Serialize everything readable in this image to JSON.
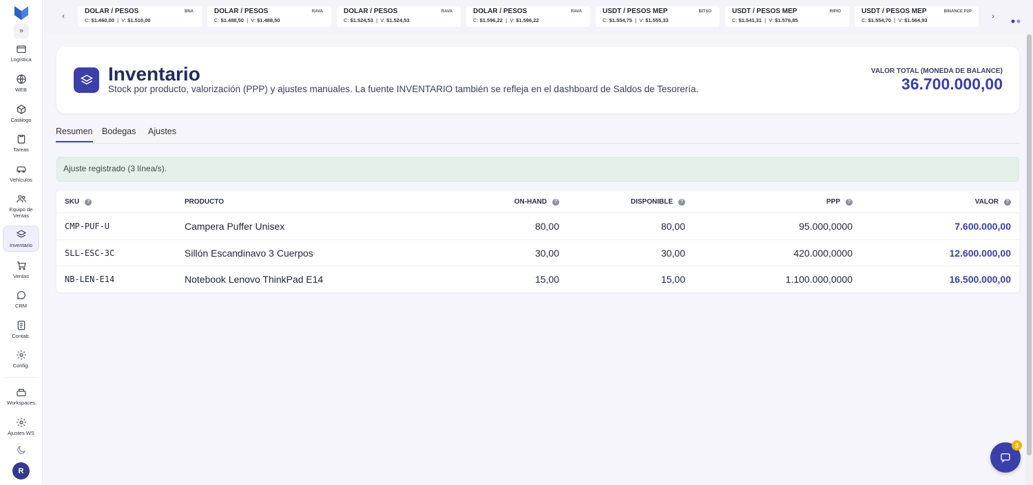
{
  "sidebar": {
    "items": [
      {
        "label": "Logística",
        "icon": "box-icon"
      },
      {
        "label": "WEB",
        "icon": "globe-icon"
      },
      {
        "label": "Catálogo",
        "icon": "cube-icon"
      },
      {
        "label": "Tareas",
        "icon": "clipboard-icon"
      },
      {
        "label": "Vehículos",
        "icon": "car-icon"
      },
      {
        "label": "Equipo de Ventas",
        "icon": "users-icon"
      },
      {
        "label": "Inventario",
        "icon": "layers-icon"
      },
      {
        "label": "Ventas",
        "icon": "cart-icon"
      },
      {
        "label": "CRM",
        "icon": "chat-icon"
      },
      {
        "label": "Contab.",
        "icon": "ledger-icon"
      },
      {
        "label": "Config.",
        "icon": "gear-icon"
      },
      {
        "label": "Workspaces",
        "icon": "workspace-icon"
      },
      {
        "label": "Ajustes WS",
        "icon": "gear-icon"
      }
    ],
    "avatar": "R"
  },
  "rates": [
    {
      "title": "DOLAR / PESOS",
      "exchange": "BNA",
      "c": "$1.460,00",
      "v": "$1.510,00"
    },
    {
      "title": "DOLAR / PESOS",
      "exchange": "RAVA",
      "c": "$1.488,50",
      "v": "$1.488,50"
    },
    {
      "title": "DOLAR / PESOS",
      "exchange": "RAVA",
      "c": "$1.524,53",
      "v": "$1.524,53"
    },
    {
      "title": "DOLAR / PESOS",
      "exchange": "RAVA",
      "c": "$1.596,22",
      "v": "$1.596,22"
    },
    {
      "title": "USDT / PESOS MEP",
      "exchange": "BITSO",
      "c": "$1.554,75",
      "v": "$1.555,33"
    },
    {
      "title": "USDT / PESOS MEP",
      "exchange": "RIPIO",
      "c": "$1.541,31",
      "v": "$1.576,85"
    },
    {
      "title": "USDT / PESOS MEP",
      "exchange": "BINANCE P2P",
      "c": "$1.554,70",
      "v": "$1.564,93"
    }
  ],
  "rate_labels": {
    "c": "C:",
    "v": "V:"
  },
  "header": {
    "title": "Inventario",
    "subtitle": "Stock por producto, valorización (PPP) y ajustes manuales. La fuente INVENTARIO también se refleja en el dashboard de Saldos de Tesorería.",
    "total_label": "Valor total (moneda de balance)",
    "total_value": "36.700.000,00"
  },
  "tabs": [
    "Resumen",
    "Bodegas",
    "Ajustes"
  ],
  "alert": "Ajuste registrado (3 línea/s).",
  "table": {
    "headers": {
      "sku": "SKU",
      "product": "Producto",
      "onhand": "On-hand",
      "available": "Disponible",
      "ppp": "PPP",
      "value": "Valor"
    },
    "rows": [
      {
        "sku": "CMP-PUF-U",
        "product": "Campera Puffer Unisex",
        "onhand": "80,00",
        "available": "80,00",
        "ppp": "95.000,0000",
        "value": "7.600.000,00"
      },
      {
        "sku": "SLL-ESC-3C",
        "product": "Sillón Escandinavo 3 Cuerpos",
        "onhand": "30,00",
        "available": "30,00",
        "ppp": "420.000,0000",
        "value": "12.600.000,00"
      },
      {
        "sku": "NB-LEN-E14",
        "product": "Notebook Lenovo ThinkPad E14",
        "onhand": "15,00",
        "available": "15,00",
        "ppp": "1.100.000,0000",
        "value": "16.500.000,00"
      }
    ]
  },
  "chat_badge": "3",
  "colors": {
    "accent": "#3a40a8",
    "alert_bg": "#e3f1ea",
    "badge": "#f0b400"
  }
}
